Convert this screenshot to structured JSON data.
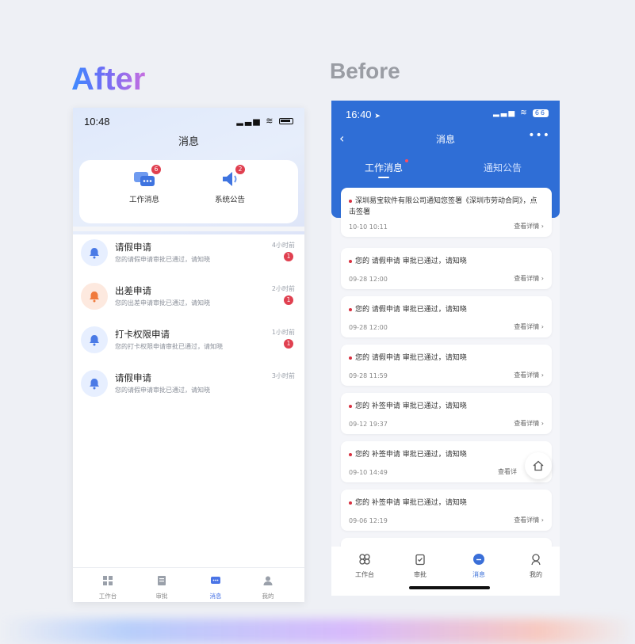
{
  "headings": {
    "after": "After",
    "before": "Before"
  },
  "after": {
    "status_time": "10:48",
    "title": "消息",
    "tabs": [
      {
        "label": "工作消息",
        "badge": "6",
        "icon": "chat-icon"
      },
      {
        "label": "系统公告",
        "badge": "2",
        "icon": "speaker-icon"
      }
    ],
    "messages": [
      {
        "title": "请假申请",
        "desc": "您的请假申请审批已通过，请知晓",
        "time": "4小时前",
        "count": "1",
        "icon": "bell-icon",
        "tone": "blue"
      },
      {
        "title": "出差申请",
        "desc": "您的出差申请审批已通过，请知晓",
        "time": "2小时前",
        "count": "1",
        "icon": "bell-icon",
        "tone": "orange"
      },
      {
        "title": "打卡权限申请",
        "desc": "您的打卡权限申请审批已通过，请知晓",
        "time": "1小时前",
        "count": "1",
        "icon": "bell-icon",
        "tone": "blue"
      },
      {
        "title": "请假申请",
        "desc": "您的请假申请审批已通过，请知晓",
        "time": "3小时前",
        "count": "",
        "icon": "bell-icon",
        "tone": "blue"
      }
    ],
    "tabbar": [
      {
        "label": "工作台",
        "icon": "grid-icon"
      },
      {
        "label": "审批",
        "icon": "document-icon"
      },
      {
        "label": "消息",
        "icon": "message-icon",
        "active": true
      },
      {
        "label": "我的",
        "icon": "user-icon"
      }
    ]
  },
  "before": {
    "status_time": "16:40",
    "battery": "66",
    "title": "消息",
    "tabs": [
      {
        "label": "工作消息",
        "active": true
      },
      {
        "label": "通知公告",
        "active": false
      }
    ],
    "messages": [
      {
        "text": "深圳易宝软件有限公司通知您签署《深圳市劳动合同》，点击签署",
        "date": "10-10 10:11",
        "detail": "查看详情"
      },
      {
        "text": "您的 请假申请 审批已通过，请知晓",
        "date": "09-28 12:00",
        "detail": "查看详情"
      },
      {
        "text": "您的 请假申请 审批已通过，请知晓",
        "date": "09-28 12:00",
        "detail": "查看详情"
      },
      {
        "text": "您的 请假申请 审批已通过，请知晓",
        "date": "09-28 11:59",
        "detail": "查看详情"
      },
      {
        "text": "您的 补签申请 审批已通过，请知晓",
        "date": "09-12 19:37",
        "detail": "查看详情"
      },
      {
        "text": "您的 补签申请 审批已通过，请知晓",
        "date": "09-10 14:49",
        "detail": "查看详"
      },
      {
        "text": "您的 补签申请 审批已通过，请知晓",
        "date": "09-06 12:19",
        "detail": "查看详情"
      }
    ],
    "tabbar": [
      {
        "label": "工作台",
        "icon": "cluster-icon"
      },
      {
        "label": "审批",
        "icon": "clipboard-icon"
      },
      {
        "label": "消息",
        "icon": "message-icon",
        "active": true
      },
      {
        "label": "我的",
        "icon": "user-icon"
      }
    ]
  },
  "colors": {
    "accent_blue": "#2f6ed6",
    "badge_red": "#e04050",
    "after_heading_start": "#3d8bff",
    "after_heading_end": "#c56ee0"
  }
}
